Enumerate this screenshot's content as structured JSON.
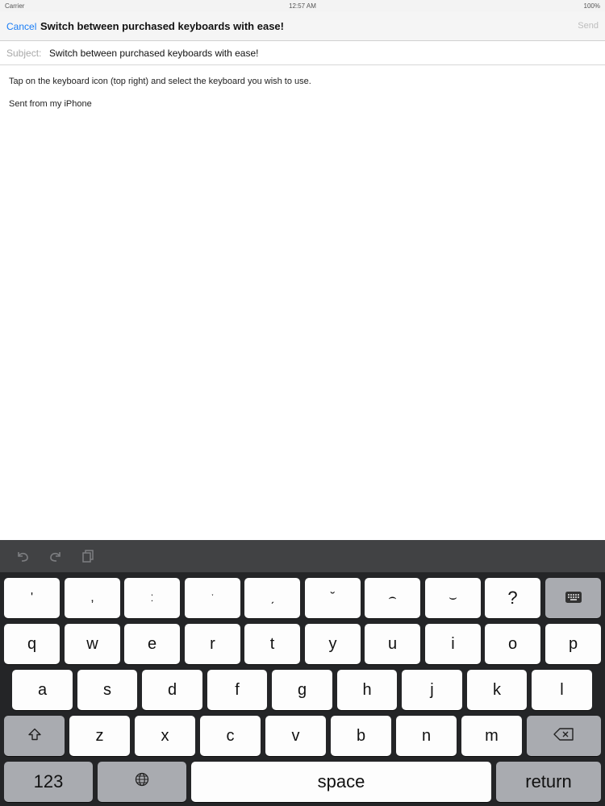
{
  "status_bar": {
    "carrier": "Carrier",
    "time": "12:57 AM",
    "battery": "100%"
  },
  "navbar": {
    "cancel_label": "Cancel",
    "title": "Switch between purchased keyboards with ease!",
    "send_label": "Send"
  },
  "subject": {
    "label": "Subject:",
    "value": "Switch between purchased keyboards with ease!"
  },
  "body": {
    "line1": "Tap on the keyboard icon (top right) and select the keyboard you wish to use.",
    "line2": "Sent from my iPhone"
  },
  "toolbar": {
    "icons": [
      "undo-icon",
      "redo-icon",
      "paste-icon"
    ]
  },
  "keyboard": {
    "row0": [
      "'",
      ",",
      "ː",
      "ˑ",
      "ˏ",
      "˘",
      "⌢",
      "⌣",
      "?"
    ],
    "row1": [
      "q",
      "w",
      "e",
      "r",
      "t",
      "y",
      "u",
      "i",
      "o",
      "p"
    ],
    "row2": [
      "a",
      "s",
      "d",
      "f",
      "g",
      "h",
      "j",
      "k",
      "l"
    ],
    "row3": [
      "z",
      "x",
      "c",
      "v",
      "b",
      "n",
      "m"
    ],
    "numbers_label": "123",
    "space_label": "space",
    "return_label": "return"
  },
  "colors": {
    "accent": "#1a7df5",
    "keyboard_bg": "#242527",
    "toolbar_bg": "#414244",
    "special_key": "#a9abb0"
  }
}
